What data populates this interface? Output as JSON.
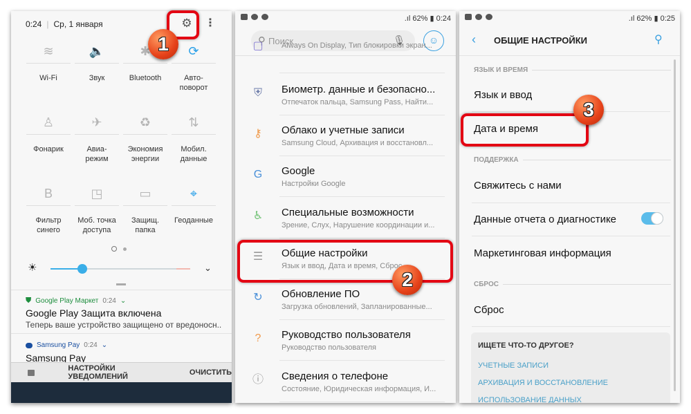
{
  "panel1": {
    "time": "0:24",
    "date": "Ср, 1 января",
    "tiles": [
      {
        "label": "Wi-Fi",
        "icon": "wifi-icon",
        "glyph": "≋",
        "active": false
      },
      {
        "label": "Звук",
        "icon": "sound-icon",
        "glyph": "🔈",
        "active": true
      },
      {
        "label": "Bluetooth",
        "icon": "bluetooth-icon",
        "glyph": "✱",
        "active": false
      },
      {
        "label": "Авто-\nповорот",
        "icon": "auto-rotate-icon",
        "glyph": "⟳",
        "active": true
      },
      {
        "label": "Фонарик",
        "icon": "flashlight-icon",
        "glyph": "♙",
        "active": false
      },
      {
        "label": "Авиа-\nрежим",
        "icon": "airplane-icon",
        "glyph": "✈",
        "active": false
      },
      {
        "label": "Экономия\nэнергии",
        "icon": "power-saving-icon",
        "glyph": "♻",
        "active": false
      },
      {
        "label": "Мобил.\nданные",
        "icon": "mobile-data-icon",
        "glyph": "⇅",
        "active": false
      },
      {
        "label": "Фильтр\nсинего",
        "icon": "blue-filter-icon",
        "glyph": "B",
        "active": false
      },
      {
        "label": "Моб. точка\nдоступа",
        "icon": "hotspot-icon",
        "glyph": "◳",
        "active": false
      },
      {
        "label": "Защищ.\nпапка",
        "icon": "secure-folder-icon",
        "glyph": "▭",
        "active": false
      },
      {
        "label": "Геоданные",
        "icon": "location-icon",
        "glyph": "⌖",
        "active": true
      }
    ],
    "brightness_percent": 23,
    "notifications": [
      {
        "app": "Google Play Маркет",
        "time": "0:24",
        "title": "Google Play Защита включена",
        "text": "Теперь ваше устройство защищено от вредоносн..",
        "color": "#1e8e3e"
      },
      {
        "app": "Samsung Pay",
        "time": "0:24",
        "title": "Samsung Pay",
        "text": "",
        "color": "#1a4fa0"
      }
    ],
    "footer": {
      "settings": "НАСТРОЙКИ УВЕДОМЛЕНИЙ",
      "clear": "ОЧИСТИТЬ"
    },
    "badge": "1"
  },
  "panel2": {
    "status": {
      "battery": "62%",
      "time": "0:24"
    },
    "search_placeholder": "Поиск",
    "rows": [
      {
        "title": "",
        "subtitle": "Always On Display, Тип блокировки экран...",
        "icon": "lock-screen-icon",
        "glyph": "▢",
        "color": "#8a7fd6"
      },
      {
        "title": "Биометр. данные и безопасно...",
        "subtitle": "Отпечаток пальца, Samsung Pass, Найти...",
        "icon": "shield-icon",
        "glyph": "⛨",
        "color": "#6a7aa8"
      },
      {
        "title": "Облако и учетные записи",
        "subtitle": "Samsung Cloud, Архивация и восстановл...",
        "icon": "key-icon",
        "glyph": "⚷",
        "color": "#f0994a"
      },
      {
        "title": "Google",
        "subtitle": "Настройки Google",
        "icon": "google-icon",
        "glyph": "G",
        "color": "#4a90d9"
      },
      {
        "title": "Специальные возможности",
        "subtitle": "Зрение, Слух, Нарушение координации и...",
        "icon": "accessibility-icon",
        "glyph": "♿",
        "color": "#6cc070"
      },
      {
        "title": "Общие настройки",
        "subtitle": "Язык и ввод, Дата и время, Сброс",
        "icon": "sliders-icon",
        "glyph": "☰",
        "color": "#999999"
      },
      {
        "title": "Обновление ПО",
        "subtitle": "Загрузка обновлений, Запланированные...",
        "icon": "software-update-icon",
        "glyph": "↻",
        "color": "#4a90d9"
      },
      {
        "title": "Руководство пользователя",
        "subtitle": "Руководство пользователя",
        "icon": "user-manual-icon",
        "glyph": "?",
        "color": "#f0994a"
      },
      {
        "title": "Сведения о телефоне",
        "subtitle": "Состояние, Юридическая информация, И...",
        "icon": "info-icon",
        "glyph": "ⓘ",
        "color": "#999999"
      }
    ],
    "badge": "2"
  },
  "panel3": {
    "status": {
      "battery": "62%",
      "time": "0:25"
    },
    "title": "ОБЩИЕ НАСТРОЙКИ",
    "sections": {
      "lang": "ЯЗЫК И ВРЕМЯ",
      "support": "ПОДДЕРЖКА",
      "reset": "СБРОС"
    },
    "items": {
      "lang_input": "Язык и ввод",
      "date_time": "Дата и время",
      "contact": "Свяжитесь с нами",
      "diagnostics": "Данные отчета о диагностике",
      "marketing": "Маркетинговая информация",
      "reset": "Сброс"
    },
    "diagnostics_enabled": true,
    "other": {
      "heading": "ИЩЕТЕ ЧТО-ТО ДРУГОЕ?",
      "links": [
        "УЧЕТНЫЕ ЗАПИСИ",
        "АРХИВАЦИЯ И ВОССТАНОВЛЕНИЕ",
        "ИСПОЛЬЗОВАНИЕ ДАННЫХ"
      ]
    },
    "badge": "3"
  }
}
